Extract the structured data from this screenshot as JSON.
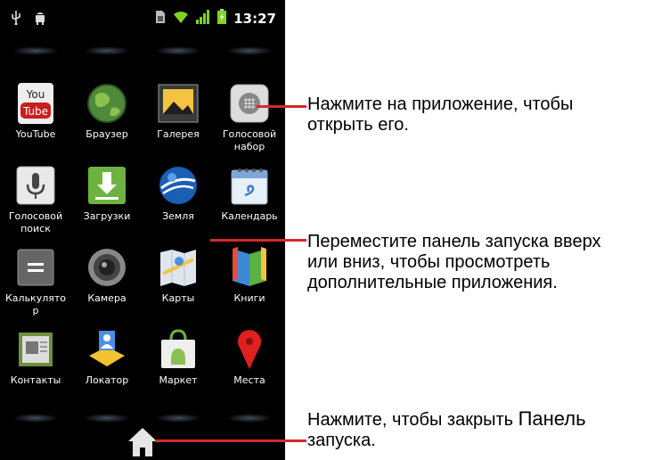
{
  "status_bar": {
    "time": "13:27",
    "icons": [
      "usb-icon",
      "android-debug-icon",
      "sim-icon",
      "wifi-icon",
      "signal-icon",
      "battery-icon"
    ]
  },
  "apps": [
    {
      "label": "YouTube",
      "icon": "youtube-icon"
    },
    {
      "label": "Браузер",
      "icon": "browser-globe-icon"
    },
    {
      "label": "Галерея",
      "icon": "gallery-icon"
    },
    {
      "label": "Голосовой набор",
      "icon": "voice-dialer-icon"
    },
    {
      "label": "Голосовой поиск",
      "icon": "voice-search-icon"
    },
    {
      "label": "Загрузки",
      "icon": "downloads-icon"
    },
    {
      "label": "Земля",
      "icon": "earth-icon"
    },
    {
      "label": "Календарь",
      "icon": "calendar-icon"
    },
    {
      "label": "Калькулято р",
      "icon": "calculator-icon"
    },
    {
      "label": "Камера",
      "icon": "camera-icon"
    },
    {
      "label": "Карты",
      "icon": "maps-icon"
    },
    {
      "label": "Книги",
      "icon": "books-icon"
    },
    {
      "label": "Контакты",
      "icon": "contacts-icon"
    },
    {
      "label": "Локатор",
      "icon": "latitude-icon"
    },
    {
      "label": "Маркет",
      "icon": "market-icon"
    },
    {
      "label": "Места",
      "icon": "places-pin-icon"
    }
  ],
  "home_button": {
    "icon": "home-icon"
  },
  "callouts": {
    "open_app": "Нажмите на приложение, чтобы открыть его.",
    "scroll": "Переместите панель запуска вверх или вниз, чтобы просмотреть дополнительные приложения.",
    "close_prefix": "Нажмите, чтобы закрыть ",
    "close_word": "Панель",
    "close_suffix": "запуска."
  },
  "colors": {
    "callout_line": "#d42a2a",
    "phone_background": "#000000"
  }
}
